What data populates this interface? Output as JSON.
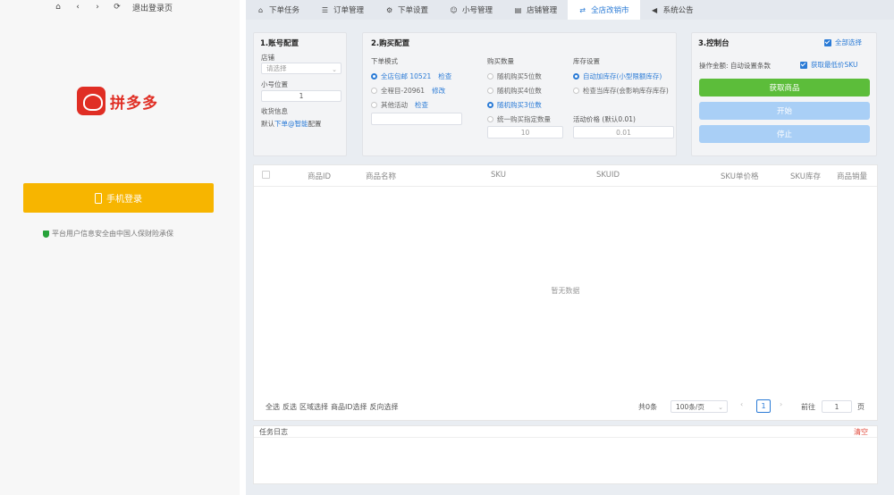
{
  "topbar": {
    "back_label": "‹",
    "forward_label": "›",
    "refresh_label": "⟳",
    "logout_label": "退出登录页"
  },
  "brand": {
    "name": "拼多多",
    "color": "#e02e24"
  },
  "login": {
    "button_label": "手机登录",
    "safety_text": "平台用户信息安全由中国人保财险承保"
  },
  "tabs": [
    {
      "label": "下单任务",
      "icon": "home-icon"
    },
    {
      "label": "订单管理",
      "icon": "list-icon"
    },
    {
      "label": "下单设置",
      "icon": "gear-icon"
    },
    {
      "label": "小号管理",
      "icon": "users-icon"
    },
    {
      "label": "店铺管理",
      "icon": "shop-icon"
    },
    {
      "label": "全店改销市",
      "icon": "share-icon"
    },
    {
      "label": "系统公告",
      "icon": "megaphone-icon"
    }
  ],
  "account_card": {
    "title": "1.账号配置",
    "shop_label": "店铺",
    "shop_placeholder": "请选择",
    "small_account_label": "小号位置",
    "small_account_value": "1",
    "receiver_label": "收货信息",
    "receiver_prefix": "默认",
    "receiver_link": "下单@智能",
    "receiver_suffix": "配置"
  },
  "buy_card": {
    "title": "2.购买配置",
    "order_mode_label": "下单模式",
    "order_modes": [
      {
        "label": "全店包邮 10521",
        "link": "检查",
        "selected": true
      },
      {
        "label": "全程目-20961",
        "link": "修改",
        "selected": false
      },
      {
        "label": "其他活动",
        "link": "检查",
        "selected": false
      }
    ],
    "quantity_label": "购买数量",
    "quantity_options": [
      {
        "label": "随机购买5位数",
        "selected": false
      },
      {
        "label": "随机购买4位数",
        "selected": false
      },
      {
        "label": "随机购买3位数",
        "selected": true
      },
      {
        "label": "统一购买指定数量",
        "selected": false
      }
    ],
    "quantity_value": "10",
    "stock_label": "库存设置",
    "stock_options": [
      {
        "label": "自动加库存(小型限额库存)",
        "selected": true
      },
      {
        "label": "检查当库存(会影响库存库存)",
        "selected": false
      }
    ],
    "price_label": "活动价格",
    "price_hint": "(默认0.01)",
    "price_value": "0.01"
  },
  "control_card": {
    "title": "3.控制台",
    "checkbox1_label": "全部选择",
    "status_label": "操作金额:",
    "status_value": "自动设置条款",
    "checkbox2_label": "获取最低价SKU",
    "fetch_button": "获取商品",
    "start_button": "开始",
    "stop_button": "停止",
    "colors": {
      "fetch": "#5cbd3a",
      "start": "#a9cff6",
      "stop": "#a9cff6"
    }
  },
  "table": {
    "columns": [
      "商品ID",
      "商品名称",
      "SKU",
      "SKUID",
      "SKU单价格",
      "SKU库存",
      "商品销量"
    ],
    "empty_text": "暂无数据"
  },
  "footer": {
    "actions": [
      "全选",
      "反选",
      "区域选择",
      "商品ID选择",
      "反向选择"
    ],
    "total": "共0条",
    "page_size": "100条/页",
    "page": "1",
    "goto_label": "前往",
    "goto_value": "1",
    "page_unit": "页"
  },
  "log": {
    "title": "任务日志",
    "clear": "清空"
  }
}
